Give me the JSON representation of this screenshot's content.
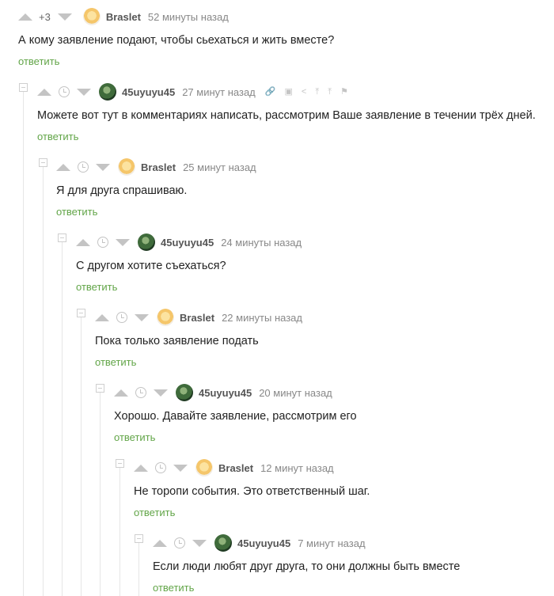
{
  "comments": [
    {
      "score": "+3",
      "author": "Braslet",
      "time": "52 минуты назад",
      "text": "А кому заявление подают, чтобы сьехаться и жить вместе?",
      "reply": "ответить",
      "avatar": "braslet-avatar"
    },
    {
      "author": "45uyuyu45",
      "time": "27 минут назад",
      "text": "Можете вот тут в комментариях написать, рассмотрим Ваше заявление в течении трёх дней.",
      "reply": "ответить",
      "avatar": "user-avatar"
    },
    {
      "author": "Braslet",
      "time": "25 минут назад",
      "text": "Я для друга спрашиваю.",
      "reply": "ответить",
      "avatar": "braslet-avatar"
    },
    {
      "author": "45uyuyu45",
      "time": "24 минуты назад",
      "text": "С другом хотите съехаться?",
      "reply": "ответить",
      "avatar": "user-avatar"
    },
    {
      "author": "Braslet",
      "time": "22 минуты назад",
      "text": "Пока только заявление подать",
      "reply": "ответить",
      "avatar": "braslet-avatar"
    },
    {
      "author": "45uyuyu45",
      "time": "20 минут назад",
      "text": "Хорошо. Давайте заявление, рассмотрим его",
      "reply": "ответить",
      "avatar": "user-avatar"
    },
    {
      "author": "Braslet",
      "time": "12 минут назад",
      "text": "Не торопи события. Это ответственный шаг.",
      "reply": "ответить",
      "avatar": "braslet-avatar"
    },
    {
      "author": "45uyuyu45",
      "time": "7 минут назад",
      "text": "Если люди любят друг друга, то они должны быть вместе",
      "reply": "ответить",
      "avatar": "user-avatar"
    }
  ],
  "colors": {
    "reply_link": "#62a548",
    "vote_arrow": "#c4c4c4",
    "thread_line": "#e6e6e6"
  },
  "action_icons": [
    "link-icon",
    "save-icon",
    "share-icon",
    "pin-icon",
    "tree-icon",
    "flag-icon"
  ]
}
